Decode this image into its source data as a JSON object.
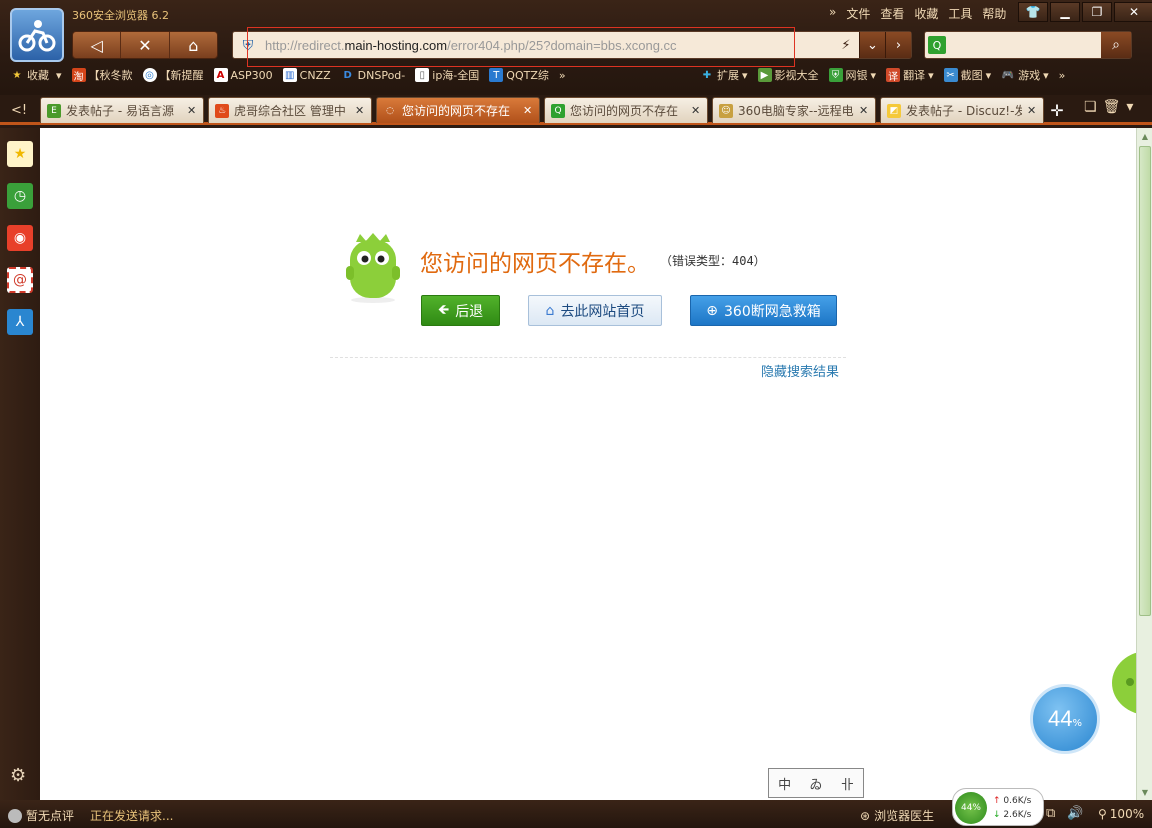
{
  "app": {
    "title": "360安全浏览器 6.2"
  },
  "menu": [
    "»",
    "文件",
    "查看",
    "收藏",
    "工具",
    "帮助"
  ],
  "address": {
    "prefix": "http://redirect.",
    "host": "main-hosting.com",
    "suffix": "/error404.php/25?domain=bbs.xcong.cc"
  },
  "bookmarks": {
    "left": [
      "收藏",
      "【秋冬款",
      "【新提醒",
      "ASP300",
      "CNZZ",
      "DNSPod-",
      "ip海-全国",
      "QQTZ综"
    ],
    "more": "»",
    "right": [
      "扩展",
      "影视大全",
      "网银",
      "翻译",
      "截图",
      "游戏"
    ]
  },
  "tabs": [
    {
      "label": "发表帖子 - 易语言源",
      "active": false
    },
    {
      "label": "虎哥综合社区 管理中",
      "active": false
    },
    {
      "label": "您访问的网页不存在",
      "active": true
    },
    {
      "label": "您访问的网页不存在",
      "active": false
    },
    {
      "label": "360电脑专家--远程电",
      "active": false
    },
    {
      "label": "发表帖子 - Discuz!-发",
      "active": false
    }
  ],
  "page": {
    "error_title": "您访问的网页不存在。",
    "error_type": "（错误类型：404）",
    "back_button": "后退",
    "home_button": "去此网站首页",
    "rescue_button": "360断网急救箱",
    "hide_results": "隐藏搜索结果",
    "ime_chars": [
      "中",
      "ゐ",
      "卝"
    ]
  },
  "speed_ball": {
    "value": "44",
    "unit": "%"
  },
  "status": {
    "rating": "暂无点评",
    "message": "正在发送请求...",
    "doctor": "浏览器医生",
    "net_percent": "44%",
    "upload": "0.6K/s",
    "download": "2.6K/s",
    "zoom": "100%"
  },
  "colors": {
    "accent_orange": "#e06a10",
    "tab_active": "#c0551a",
    "chrome_dark": "#2a1a11"
  }
}
